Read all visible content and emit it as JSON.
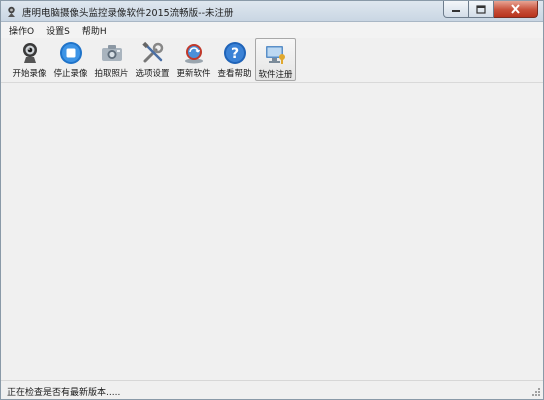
{
  "window": {
    "title": "唐明电脑摄像头监控录像软件2015流畅版--未注册"
  },
  "menu": [
    {
      "label": "操作O"
    },
    {
      "label": "设置S"
    },
    {
      "label": "帮助H"
    }
  ],
  "toolbar": [
    {
      "label": "开始录像",
      "icon": "webcam-icon"
    },
    {
      "label": "停止录像",
      "icon": "stop-icon"
    },
    {
      "label": "拍取照片",
      "icon": "camera-icon"
    },
    {
      "label": "选项设置",
      "icon": "tools-icon"
    },
    {
      "label": "更新软件",
      "icon": "update-icon"
    },
    {
      "label": "查看帮助",
      "icon": "help-icon"
    },
    {
      "label": "软件注册",
      "icon": "register-icon"
    }
  ],
  "status": {
    "text": "正在检查是否有最新版本....."
  },
  "colors": {
    "accent_blue": "#1f73c9",
    "close_red": "#c7503a"
  }
}
